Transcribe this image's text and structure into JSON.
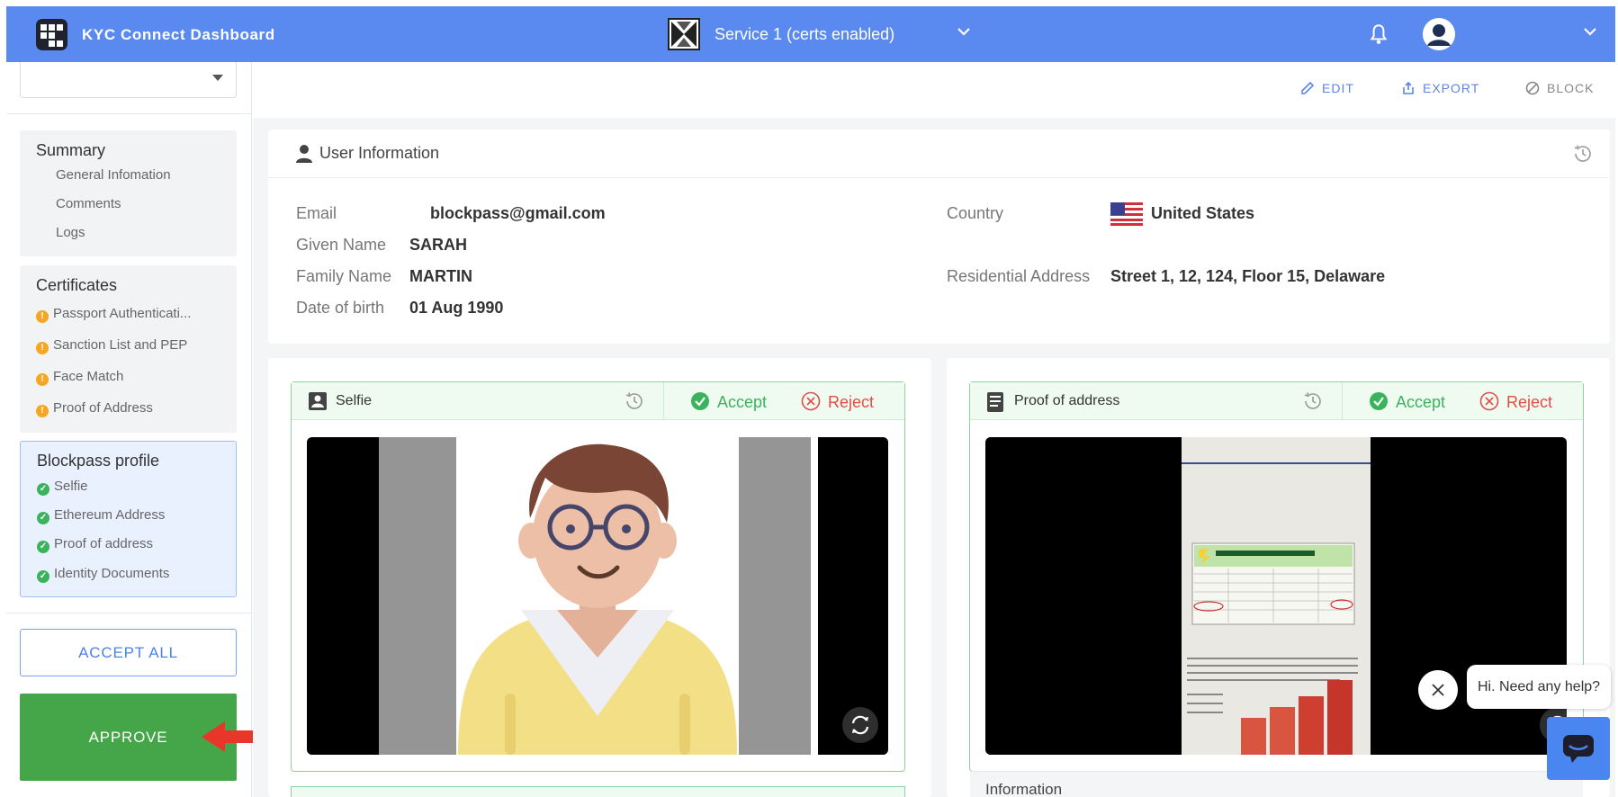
{
  "header": {
    "app_title": "KYC Connect Dashboard",
    "service_name": "Service 1 (certs enabled)",
    "icons": [
      "logo-icon",
      "chevron-down-icon",
      "bell-icon",
      "user-avatar-icon"
    ]
  },
  "sidebar": {
    "summary": {
      "title": "Summary",
      "items": [
        "General Infomation",
        "Comments",
        "Logs"
      ]
    },
    "certificates": {
      "title": "Certificates",
      "items": [
        "Passport Authenticati...",
        "Sanction List and PEP",
        "Face Match",
        "Proof of Address"
      ],
      "status_color": "#f5a623"
    },
    "blockpass_profile": {
      "title": "Blockpass profile",
      "items": [
        "Selfie",
        "Ethereum Address",
        "Proof of address",
        "Identity Documents"
      ],
      "status_color": "#3bb35c"
    },
    "accept_all_label": "ACCEPT ALL",
    "approve_label": "APPROVE",
    "approve_color": "#45a549"
  },
  "toolbar": {
    "edit_label": "EDIT",
    "export_label": "EXPORT",
    "block_label": "BLOCK"
  },
  "user_info": {
    "title": "User Information",
    "email_label": "Email",
    "email": "blockpass@gmail.com",
    "given_name_label": "Given Name",
    "given_name": "SARAH",
    "family_name_label": "Family Name",
    "family_name": "MARTIN",
    "dob_label": "Date of birth",
    "dob": "01 Aug 1990",
    "country_label": "Country",
    "country": "United States",
    "address_label": "Residential Address",
    "address": "Street 1, 12, 124, Floor 15, Delaware"
  },
  "documents": [
    {
      "name": "Selfie",
      "accept_label": "Accept",
      "reject_label": "Reject"
    },
    {
      "name": "Proof of address",
      "accept_label": "Accept",
      "reject_label": "Reject",
      "below_label": "Information"
    }
  ],
  "chat": {
    "greeting": "Hi. Need any help?"
  },
  "colors": {
    "header": "#5a8af0",
    "accent": "#4d80ec",
    "accept": "#3bb35c",
    "reject": "#e04e45",
    "annotation_arrow": "#e8372a"
  }
}
